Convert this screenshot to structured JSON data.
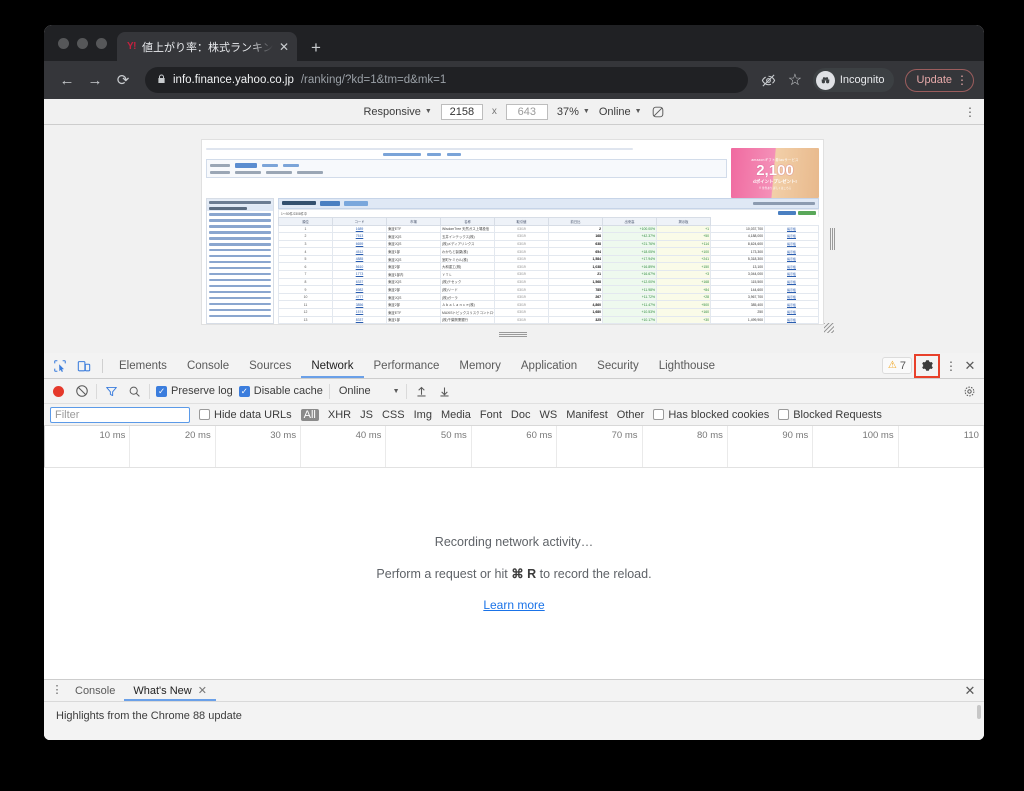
{
  "browser": {
    "tab": {
      "title": "値上がり率：株式ランキング - Yah",
      "favicon_text": "Y!",
      "close_label": "✕"
    },
    "new_tab_label": "+",
    "nav": {
      "back": "←",
      "forward": "→",
      "reload": "⟳"
    },
    "omnibox": {
      "lock_icon": "lock-icon",
      "host": "info.finance.yahoo.co.jp",
      "path": "/ranking/?kd=1&tm=d&mk=1"
    },
    "right_icons": {
      "cookie_blocked": "eye-slash-icon",
      "bookmark": "☆"
    },
    "incognito_label": "Incognito",
    "update_label": "Update",
    "update_kebab": "⋮"
  },
  "device_toolbar": {
    "device_label": "Responsive",
    "width": "2158",
    "height": "643",
    "zoom_label": "37%",
    "throttle_label": "Online",
    "rotate_icon": "rotate-icon",
    "kebab": "⋮"
  },
  "page": {
    "sidebar_title": "マーケット関連ランキング",
    "sidebar_selected": "値上がり率",
    "sidebar_items": [
      "値下がり率",
      "ストップ高",
      "ストップ安",
      "年初来高値更新",
      "年初来安値更新",
      "出来高",
      "株価当り出来高",
      "出来高増加率",
      "出来高減少率",
      "売買代金上位",
      "売買代金下位",
      "時価総額上位",
      "時価総額下位",
      "連続増配率上位",
      "連続増配率下位",
      "配当利回り（会社予想）",
      "高PER（会社予想）",
      "低PER（会社予想）"
    ],
    "content_title": "値上がり率",
    "content_tab_all": "全市場",
    "content_tab_sub": "デイリー",
    "updated_label": "最終更新日時：2021年3月19日15時40分",
    "rows_caption": "1～50件/2308件中",
    "table_headers": [
      "順位",
      "コード",
      "市場",
      "名称",
      "取引値",
      "前日比",
      "出来高",
      "掲示板"
    ],
    "table_rows": [
      [
        "1",
        "1689",
        "東証ETF",
        "WisdomTree 天然ガス上場投信",
        "03/19",
        "2",
        "+100.00%",
        "+1",
        "10,037,700",
        "掲示板"
      ],
      [
        "2",
        "7513",
        "東証JQS",
        "玉井インテックス(株)",
        "03/19",
        "168",
        "+42.37%",
        "+50",
        "4,188,000",
        "掲示板"
      ],
      [
        "3",
        "6659",
        "東証JQS",
        "(株)メディアリンクス",
        "03/19",
        "638",
        "+21.76%",
        "+114",
        "8,624,600",
        "掲示板"
      ],
      [
        "4",
        "4512",
        "東証1部",
        "わかもと製薬(株)",
        "03/19",
        "654",
        "+18.05%",
        "+100",
        "173,300",
        "掲示板"
      ],
      [
        "5",
        "4885",
        "東証JQS",
        "室町ケミカル(株)",
        "03/19",
        "1,584",
        "+17.94%",
        "+241",
        "5,318,300",
        "掲示板"
      ],
      [
        "6",
        "5610",
        "東証2部",
        "大和重工(株)",
        "03/19",
        "1,038",
        "+16.89%",
        "+150",
        "13,100",
        "掲示板"
      ],
      [
        "7",
        "1773",
        "東証1部内",
        "ＹＴＬ",
        "03/19",
        "21",
        "+16.67%",
        "+3",
        "3,044,000",
        "掲示板"
      ],
      [
        "8",
        "6337",
        "東証JQS",
        "(株)テセック",
        "03/19",
        "1,568",
        "+12.00%",
        "+168",
        "115,500",
        "掲示板"
      ],
      [
        "9",
        "6982",
        "東証2部",
        "(株)リード",
        "03/19",
        "785",
        "+11.98%",
        "+84",
        "144,600",
        "掲示板"
      ],
      [
        "10",
        "4777",
        "東証JQS",
        "(株)ガーラ",
        "03/19",
        "267",
        "+11.72%",
        "+28",
        "3,967,700",
        "掲示板"
      ],
      [
        "11",
        "3856",
        "東証2部",
        "Ａｂａｌａｎｃｅ(株)",
        "03/19",
        "4,860",
        "+11.47%",
        "+500",
        "385,400",
        "掲示板"
      ],
      [
        "12",
        "1574",
        "東証ETF",
        "MAXISトピックスリスクコントロール(20%)",
        "03/19",
        "1,680",
        "+10.53%",
        "+160",
        "250",
        "掲示板"
      ],
      [
        "13",
        "8337",
        "東証1部",
        "(株)千葉興業銀行",
        "03/19",
        "325",
        "+10.17%",
        "+30",
        "1,499,900",
        "掲示板"
      ]
    ]
  },
  "devtools": {
    "inspect_icon": "inspect-element-icon",
    "device_toggle_icon": "device-toolbar-icon",
    "tabs": [
      "Elements",
      "Console",
      "Sources",
      "Network",
      "Performance",
      "Memory",
      "Application",
      "Security",
      "Lighthouse"
    ],
    "active_tab": "Network",
    "warning_count": "7",
    "warning_icon": "warning-triangle-icon",
    "settings_icon": "gear-icon",
    "more_icon": "⋮",
    "close_icon": "✕",
    "highlight_color": "#e8402a",
    "accent_color": "#6aa0e8"
  },
  "network_toolbar": {
    "record_icon": "record-button",
    "clear_icon": "clear-icon",
    "filter_icon": "filter-funnel-icon",
    "search_icon": "search-icon",
    "preserve_log": {
      "label": "Preserve log",
      "checked": true
    },
    "disable_cache": {
      "label": "Disable cache",
      "checked": true
    },
    "throttling": "Online",
    "import_icon": "import-har-icon",
    "export_icon": "export-har-icon",
    "settings_icon": "gear-icon"
  },
  "filter_bar": {
    "placeholder": "Filter",
    "value": "",
    "hide_data_urls": {
      "label": "Hide data URLs",
      "checked": false
    },
    "types": [
      "All",
      "XHR",
      "JS",
      "CSS",
      "Img",
      "Media",
      "Font",
      "Doc",
      "WS",
      "Manifest",
      "Other"
    ],
    "selected_type": "All",
    "has_blocked_cookies": {
      "label": "Has blocked cookies",
      "checked": false
    },
    "blocked_requests": {
      "label": "Blocked Requests",
      "checked": false
    }
  },
  "timeline": {
    "ticks": [
      "10 ms",
      "20 ms",
      "30 ms",
      "40 ms",
      "50 ms",
      "60 ms",
      "70 ms",
      "80 ms",
      "90 ms",
      "100 ms",
      "110"
    ]
  },
  "empty_state": {
    "line1": "Recording network activity…",
    "line2_pre": "Perform a request or hit ",
    "line2_key": "⌘ R",
    "line2_post": " to record the reload.",
    "link": "Learn more"
  },
  "drawer": {
    "kebab": "⋮",
    "tabs": [
      {
        "label": "Console",
        "closable": false,
        "active": false
      },
      {
        "label": "What's New",
        "closable": true,
        "active": true
      }
    ],
    "close_icon": "✕",
    "content": "Highlights from the Chrome 88 update"
  }
}
